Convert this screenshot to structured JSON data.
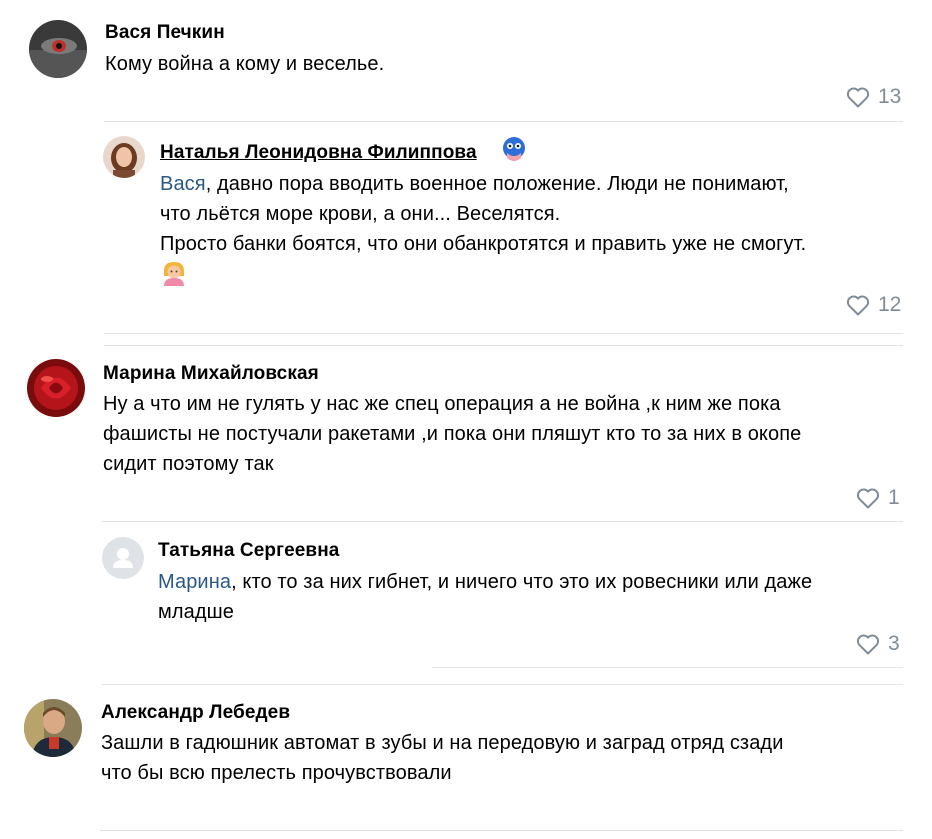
{
  "comments": [
    {
      "author": "Вася Печкин",
      "text": "Кому война а кому и веселье.",
      "likes": "13",
      "replies": [
        {
          "author": "Наталья Леонидовна Филиппова",
          "mention": "Вася",
          "text_line1": ", давно пора вводить военное положение. Люди не понимают,",
          "text_line2": "что льётся море крови, а они... Веселятся.",
          "text_line3": "Просто банки боятся, что они обанкротятся и править уже не смогут.",
          "likes": "12"
        }
      ]
    },
    {
      "author": "Марина Михайловская",
      "text_line1": "Ну а что им не гулять у нас же спец операция а не война ,к ним же пока",
      "text_line2": "фашисты не постучали ракетами ,и пока они пляшут кто то за них в окопе",
      "text_line3": "сидит поэтому так",
      "likes": "1",
      "replies": [
        {
          "author": "Татьяна Сергеевна",
          "mention": "Марина",
          "text_line1": ", кто то за них гибнет, и ничего что это их ровесники или даже",
          "text_line2": "младше",
          "likes": "3"
        }
      ]
    },
    {
      "author": "Александр Лебедев",
      "text_line1": "Зашли в гадюшник автомат в зубы и на передовую и заград отряд сзади",
      "text_line2": "что бы всю прелесть прочувствовали"
    }
  ],
  "icons": {
    "like": "heart-outline-icon",
    "badge": "mask-badge-icon",
    "emoji": "person-emoji-icon"
  },
  "colors": {
    "mention": "#2a5885",
    "meta": "#818c99",
    "divider": "#e1e3e6"
  }
}
